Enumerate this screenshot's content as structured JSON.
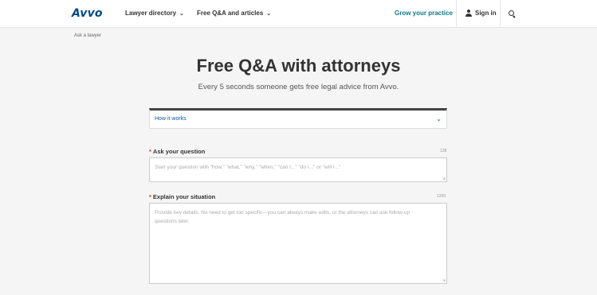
{
  "header": {
    "logo": "Avvo",
    "nav": [
      {
        "label": "Lawyer directory"
      },
      {
        "label": "Free Q&A and articles"
      }
    ],
    "grow_link": "Grow your practice",
    "signin_label": "Sign in"
  },
  "breadcrumb": "Ask a lawyer",
  "page": {
    "title": "Free Q&A with attorneys",
    "subtitle": "Every 5 seconds someone gets free legal advice from Avvo."
  },
  "how_it_works": {
    "label": "How it works"
  },
  "form": {
    "question": {
      "label": "Ask your question",
      "counter": "128",
      "placeholder": "Start your question with \"how,\" \"what,\" \"why,\" \"when,\" \"can I...\" \"do I...\" or \"will I...\""
    },
    "situation": {
      "label": "Explain your situation",
      "counter": "1200",
      "placeholder": "Provide key details. No need to get too specific—you can always make edits, or the attorneys can ask follow-up questions later."
    }
  },
  "colors": {
    "brand": "#00478e",
    "link": "#0b7a8a",
    "accent_link": "#0b5aa6"
  }
}
